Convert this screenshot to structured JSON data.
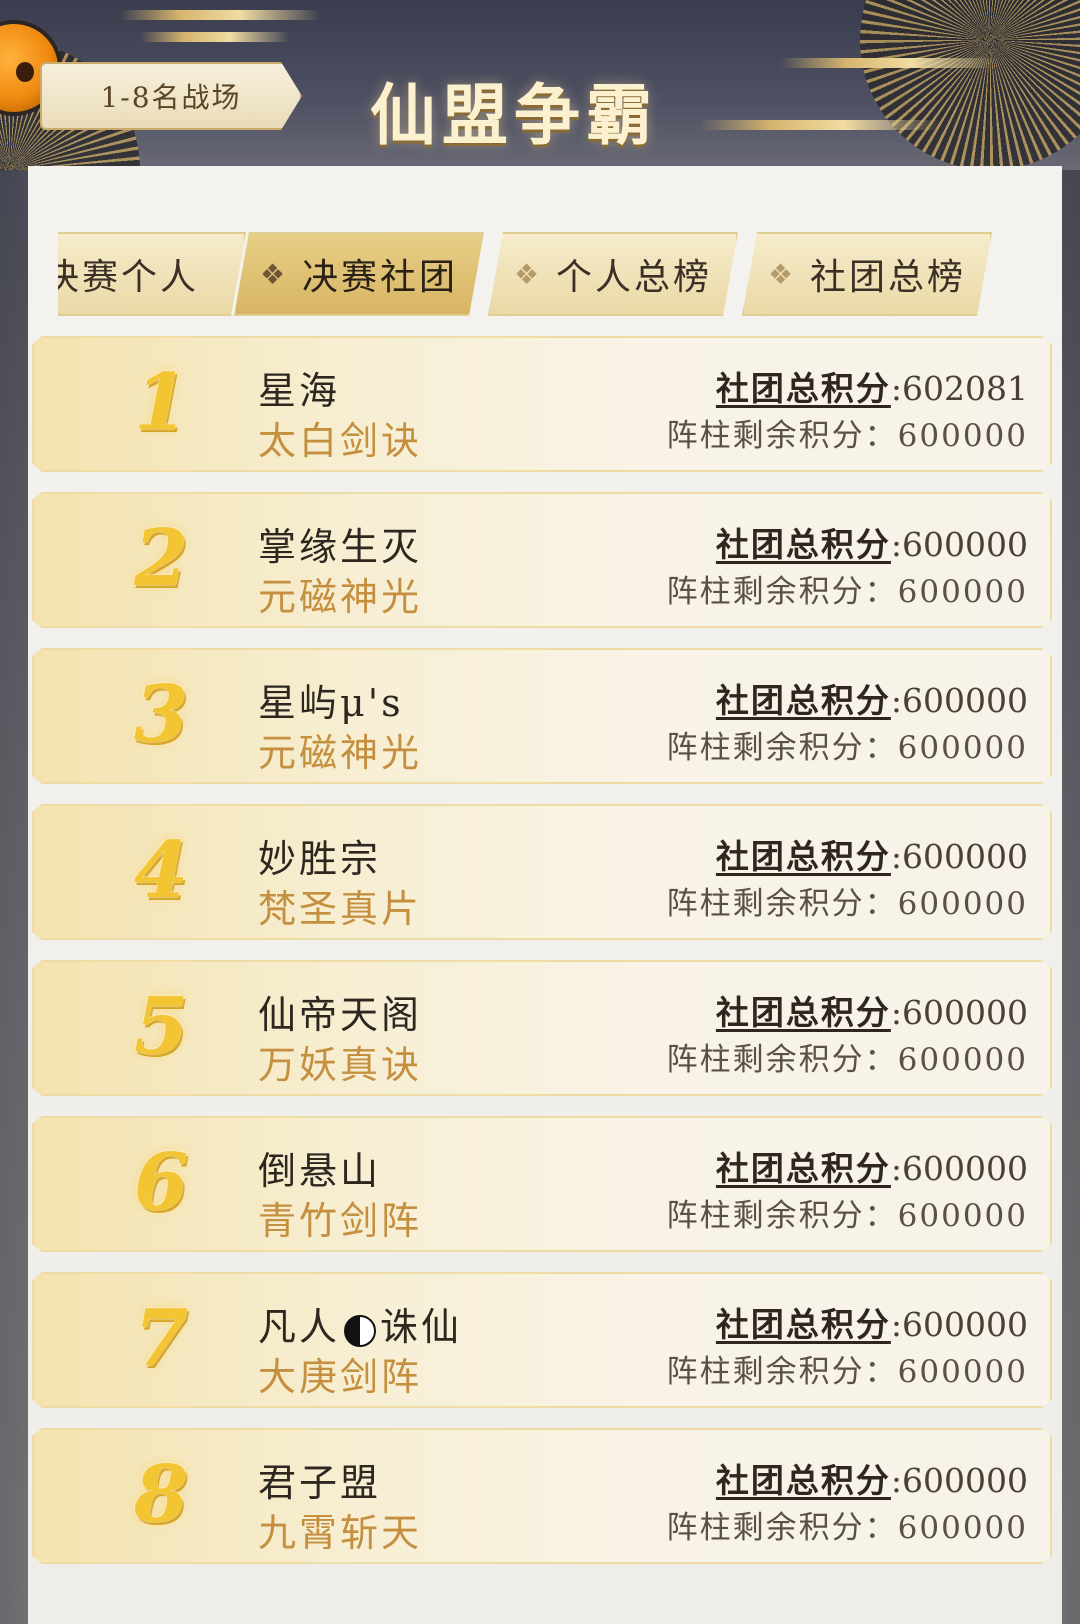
{
  "header": {
    "arena_label": "1-8名战场",
    "title": "仙盟争霸"
  },
  "tabs": [
    {
      "label": "决赛个人",
      "active": false
    },
    {
      "label": "决赛社团",
      "active": true
    },
    {
      "label": "个人总榜",
      "active": false
    },
    {
      "label": "社团总榜",
      "active": false
    }
  ],
  "labels": {
    "total_score": "社团总积分",
    "remain_score": "阵柱剩余积分："
  },
  "rows": [
    {
      "rank": "1",
      "name": "星海",
      "skill": "太白剑诀",
      "total": ":602081",
      "remain": "600000"
    },
    {
      "rank": "2",
      "name": "掌缘生灭",
      "skill": "元磁神光",
      "total": ":600000",
      "remain": "600000"
    },
    {
      "rank": "3",
      "name": "星屿μ's",
      "skill": "元磁神光",
      "total": ":600000",
      "remain": "600000"
    },
    {
      "rank": "4",
      "name": "妙胜宗",
      "skill": "梵圣真片",
      "total": ":600000",
      "remain": "600000"
    },
    {
      "rank": "5",
      "name": "仙帝天阁",
      "skill": "万妖真诀",
      "total": ":600000",
      "remain": "600000"
    },
    {
      "rank": "6",
      "name": "倒悬山",
      "skill": "青竹剑阵",
      "total": ":600000",
      "remain": "600000"
    },
    {
      "rank": "7",
      "name_a": "凡人",
      "name_icon": "yin-yang-icon",
      "name_b": "诛仙",
      "skill": "大庚剑阵",
      "total": ":600000",
      "remain": "600000"
    },
    {
      "rank": "8",
      "name": "君子盟",
      "skill": "九霄斩天",
      "total": ":600000",
      "remain": "600000"
    }
  ]
}
